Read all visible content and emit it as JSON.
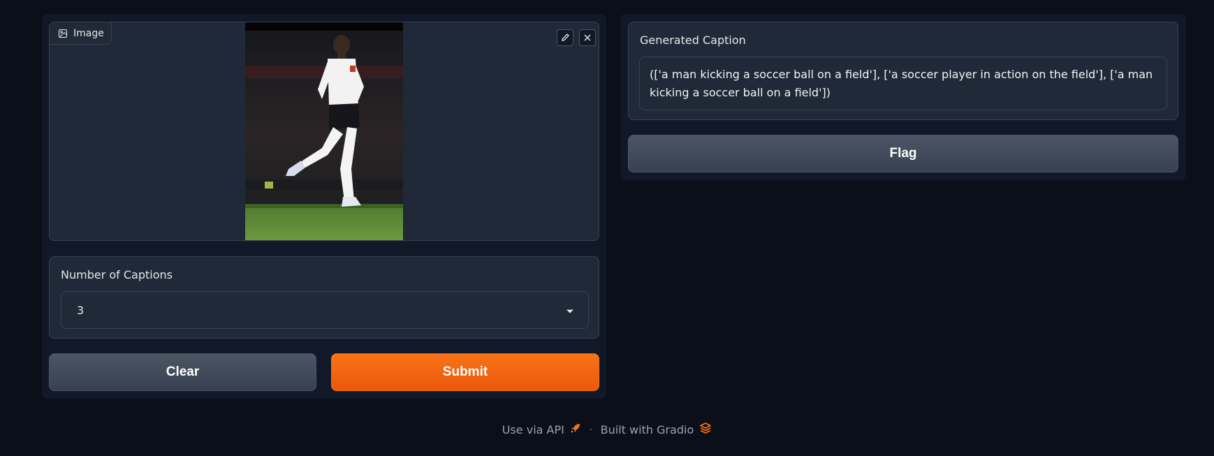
{
  "input": {
    "image_label": "Image",
    "image_icon": "image-icon",
    "edit_icon": "pencil-icon",
    "close_icon": "close-icon"
  },
  "captions_dropdown": {
    "label": "Number of Captions",
    "value": "3",
    "icon": "chevron-down-icon"
  },
  "actions": {
    "clear_label": "Clear",
    "submit_label": "Submit"
  },
  "output": {
    "label": "Generated Caption",
    "text": "(['a man kicking a soccer ball on a field'], ['a soccer player in action on the field'], ['a man kicking a soccer ball on a field'])"
  },
  "flag_label": "Flag",
  "footer": {
    "api_label": "Use via API",
    "api_icon": "rocket-icon",
    "built_label": "Built with Gradio",
    "gradio_icon": "gradio-logo-icon",
    "separator": "·"
  },
  "colors": {
    "accent": "#f97316",
    "background": "#0b0f19",
    "panel": "#111827",
    "block": "#1f2937"
  }
}
